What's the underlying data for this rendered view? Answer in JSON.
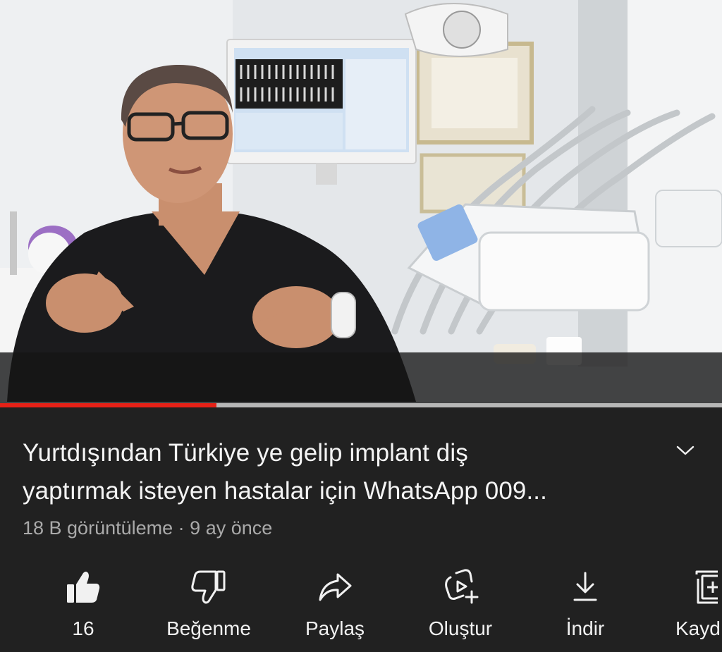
{
  "video": {
    "progress_fraction": 0.3,
    "colors": {
      "progress": "#e62117",
      "track": "#b7b7b7"
    }
  },
  "details": {
    "title_line1": "Yurtdışından Türkiye ye gelip implant diş",
    "title_line2": "yaptırmak isteyen hastalar için WhatsApp 009...",
    "views": "18 B görüntüleme",
    "separator": "·",
    "age": "9 ay önce",
    "expand_icon": "chevron-down-icon"
  },
  "actions": [
    {
      "id": "like",
      "label": "16",
      "icon": "thumbs-up-filled-icon"
    },
    {
      "id": "dislike",
      "label": "Beğenme",
      "icon": "thumbs-down-icon"
    },
    {
      "id": "share",
      "label": "Paylaş",
      "icon": "share-icon"
    },
    {
      "id": "create",
      "label": "Oluştur",
      "icon": "remix-icon"
    },
    {
      "id": "download",
      "label": "İndir",
      "icon": "download-icon"
    },
    {
      "id": "save",
      "label": "Kayd",
      "icon": "save-playlist-icon"
    }
  ]
}
